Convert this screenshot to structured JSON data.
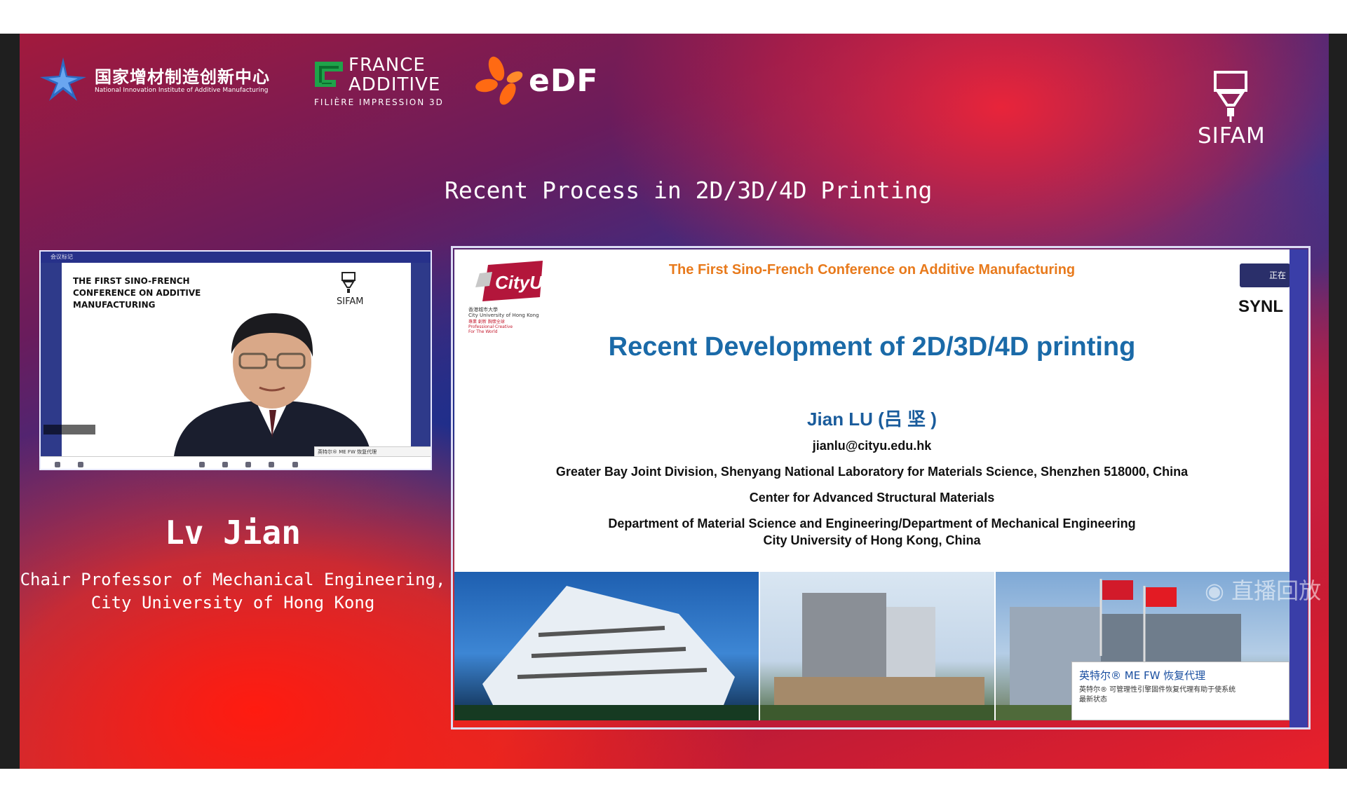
{
  "header": {
    "nam_logo_cn": "国家增材制造创新中心",
    "nam_logo_en": "National Innovation Institute of Additive Manufacturing",
    "france_additive_line1": "FRANCE",
    "france_additive_line2": "ADDITIVE",
    "france_additive_line3": "FILIÈRE IMPRESSION 3D",
    "edf_logo": "eDF",
    "sifam_logo": "SIFAM",
    "talk_title": "Recent Process in 2D/3D/4D Printing"
  },
  "webcam": {
    "top_label": "会议标记",
    "conference_text": "THE FIRST SINO-FRENCH CONFERENCE ON ADDITIVE MANUFACTURING",
    "conference_lines": [
      "THE FIRST SINO-FRENCH",
      "CONFERENCE ON ADDITIVE",
      "MANUFACTURING"
    ],
    "sifam_small": "SIFAM",
    "notification": "英特尔® ME FW 恢复代理"
  },
  "speaker": {
    "name": "Lv Jian",
    "title_line1": "Chair Professor of Mechanical Engineering,",
    "title_line2": "City University of Hong Kong"
  },
  "slide": {
    "conference": "The First Sino-French Conference on Additive Manufacturing",
    "cityu_logo": "CityU",
    "cityu_sub1": "香港城市大學",
    "cityu_sub2": "City University of Hong Kong",
    "cityu_red1": "專業 創新 胸懷全球",
    "cityu_red2": "Professional·Creative",
    "cityu_red3": "For The World",
    "synl": "SYNL",
    "synl_popup": "正在",
    "title": "Recent Development of 2D/3D/4D printing",
    "author": "Jian  LU (吕  坚 )",
    "email": "jianlu@cityu.edu.hk",
    "affiliation1": "Greater Bay Joint Division, Shenyang National Laboratory for Materials Science, Shenzhen 518000, China",
    "affiliation2": "Center for Advanced Structural Materials",
    "affiliation3": "Department of Material Science and Engineering/Department of Mechanical Engineering",
    "affiliation4": "City University of Hong Kong, China",
    "notification_title": "英特尔® ME FW 恢复代理",
    "notification_body": "英特尔® 可管理性引擎固件恢复代理有助于使系统",
    "notification_body2": "最新状态"
  },
  "overlay": {
    "watermark": "直播回放"
  },
  "colors": {
    "conference_orange": "#e87a1c",
    "title_blue": "#1a6aa8",
    "edf_orange": "#ff6a13",
    "fa_green": "#1fa34a"
  }
}
